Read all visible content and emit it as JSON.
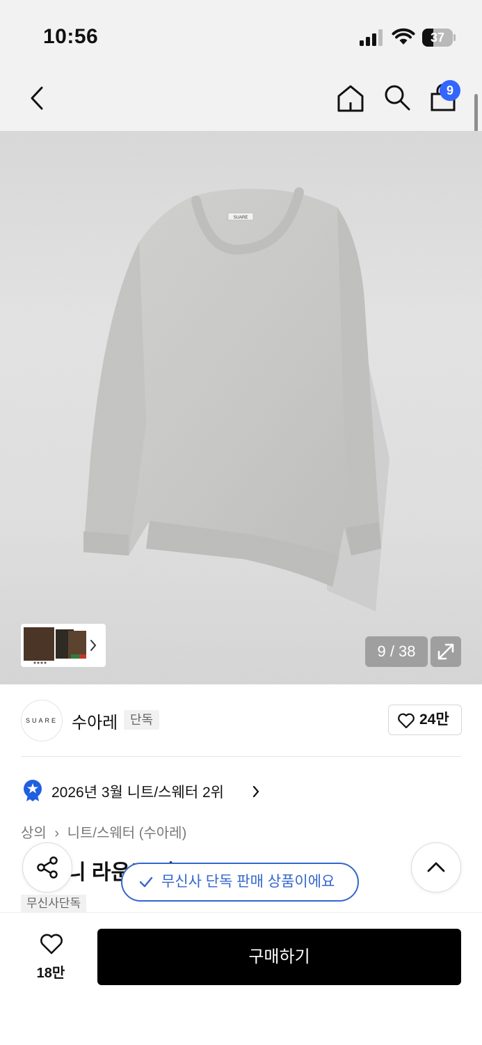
{
  "status_bar": {
    "time": "10:56",
    "battery_level": "37",
    "battery_fraction": 0.37
  },
  "nav": {
    "cart_count": "9",
    "icons": [
      "back-chevron-icon",
      "home-icon",
      "search-icon",
      "shopping-bag-icon"
    ]
  },
  "gallery": {
    "counter": "9 / 38",
    "logo_label": "SUARE"
  },
  "brand": {
    "logo": "SUARE",
    "name": "수아레",
    "tag": "단독",
    "like_count": "24만"
  },
  "ranking": {
    "text": "2026년 3월 니트/스웨터 2위"
  },
  "breadcrumb": {
    "category": "상의",
    "subcategory": "니트/스웨터 (수아레)"
  },
  "product": {
    "title_visible": "니 라운드 니트 - 12 COLOR",
    "tag": "무신사단독"
  },
  "toast": {
    "text": "무신사 단독 판매 상품이에요"
  },
  "bottom": {
    "like_count": "18만",
    "buy_label": "구매하기"
  },
  "colors": {
    "accent_blue": "#3366ff",
    "toast_blue": "#3366cc",
    "buy_bg": "#000000"
  }
}
